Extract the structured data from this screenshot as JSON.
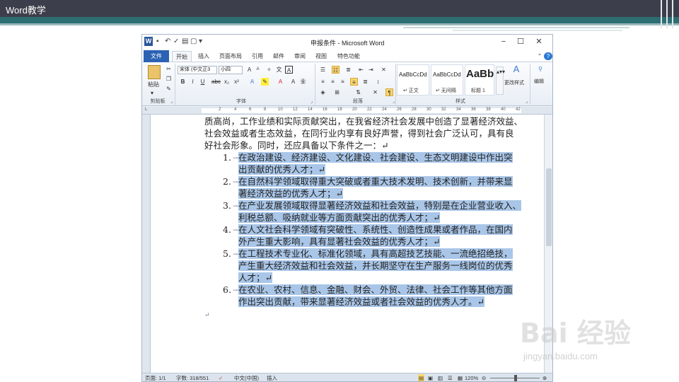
{
  "slide": {
    "title": "Word教学"
  },
  "window": {
    "title": "申报条件 - Microsoft Word",
    "logo_letter": "W",
    "minimize": "−",
    "maximize": "☐",
    "close": "✕"
  },
  "tabs": [
    "文件",
    "开始",
    "插入",
    "页面布局",
    "引用",
    "邮件",
    "审阅",
    "视图",
    "特色功能"
  ],
  "ribbon": {
    "paste_label": "粘贴",
    "font_name": "宋体 (中文正3",
    "font_size": "小四",
    "styles": [
      {
        "sample": "AaBbCcDd",
        "name": "↵ 正文"
      },
      {
        "sample": "AaBbCcDd",
        "name": "↵ 无间隔"
      },
      {
        "sample": "AaBb",
        "name": "标题 1"
      }
    ],
    "change_styles": "更改样式",
    "edit": "编辑",
    "groups": {
      "clipboard": "剪贴板",
      "font": "字体",
      "paragraph": "段落",
      "styles": "样式"
    }
  },
  "ruler_numbers": [
    "L",
    "2",
    "4",
    "6",
    "8",
    "10",
    "12",
    "14",
    "16",
    "18",
    "20",
    "22",
    "24",
    "26",
    "28",
    "30",
    "32",
    "34",
    "36",
    "38",
    "40",
    "42"
  ],
  "document": {
    "intro_lines": [
      "质高尚，工作业绩和实际贡献突出，在我省经济社会发展中创造了显著经济效益、",
      "社会效益或者生态效益，在同行业内享有良好声誉，得到社会广泛认可，具有良",
      "好社会形象。同时，还应具备以下条件之一：↵"
    ],
    "items": [
      {
        "number": "1.",
        "lines": [
          "在政治建设、经济建设、文化建设、社会建设、生态文明建设中作出突",
          "出贡献的优秀人才；↵"
        ]
      },
      {
        "number": "2.",
        "lines": [
          "在自然科学领域取得重大突破或者重大技术发明、技术创新，并带来显",
          "著经济效益的优秀人才；↵"
        ]
      },
      {
        "number": "3.",
        "lines": [
          "在产业发展领域取得显著经济效益和社会效益，特别是在企业营业收入、",
          "利税总额、吸纳就业等方面贡献突出的优秀人才；↵"
        ]
      },
      {
        "number": "4.",
        "lines": [
          "在人文社会科学领域有突破性、系统性、创造性成果或者作品，在国内",
          "外产生重大影响，具有显著社会效益的优秀人才；↵"
        ]
      },
      {
        "number": "5.",
        "lines": [
          "在工程技术专业化、标准化领域，具有高超技艺技能、一流绝招绝技，",
          "产生重大经济效益和社会效益，并长期坚守在生产服务一线岗位的优秀",
          "人才；↵"
        ]
      },
      {
        "number": "6.",
        "lines": [
          "在农业、农村、信息、金融、财会、外贸、法律、社会工作等其他方面",
          "作出突出贡献，带来显著经济效益或者社会效益的优秀人才。↵"
        ]
      }
    ],
    "tab_arrow": "→",
    "end_mark": "↵"
  },
  "status": {
    "page": "页面: 1/1",
    "words": "字数: 318/551",
    "language": "中文(中国)",
    "mode": "插入",
    "zoom": "120%"
  },
  "watermark": {
    "main": "Bai 经验",
    "sub": "jingyan.baidu.com"
  },
  "colors": {
    "selection": "#a9c6e8",
    "header": "#3c3f4b",
    "stripe": "#2d6e73",
    "file_tab": "#2b62b4"
  }
}
